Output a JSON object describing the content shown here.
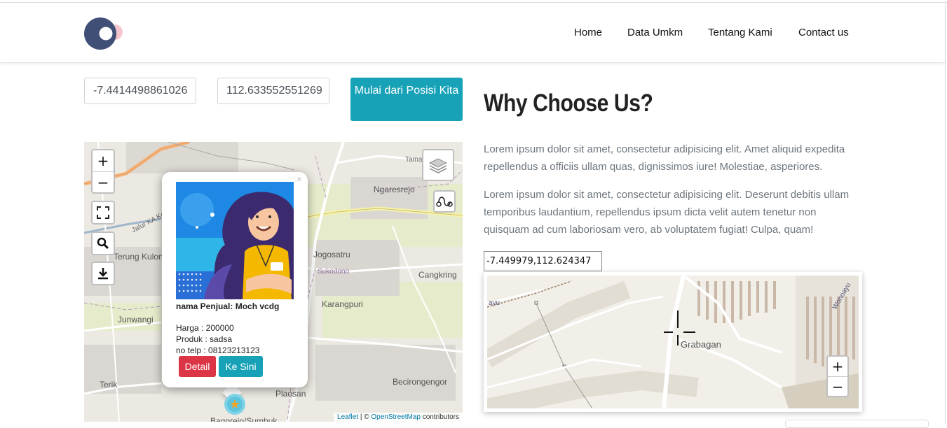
{
  "nav": {
    "items": [
      "Home",
      "Data Umkm",
      "Tentang Kami",
      "Contact us"
    ]
  },
  "start": {
    "lat_value": "-7.4414498861026",
    "lng_value": "112.633552551269",
    "button_label": "Mulai dari Posisi Kita"
  },
  "map1": {
    "labels": [
      "Ngaresrejo",
      "Jogosatru",
      "Sukodono",
      "Cangkring",
      "Karangpuri",
      "Terung Kulon",
      "Junwangi",
      "Terik",
      "Becirongengor",
      "Plaosan",
      "Jalur KA Kerta",
      "Tamat",
      "Bagorejo/Sumbuk"
    ],
    "popup": {
      "close": "×",
      "name": "nama Penjual: Moch vcdg",
      "harga": "Harga : 200000",
      "produk": "Produk : sadsa",
      "telp": "no telp : 08123213123",
      "detail_label": "Detail",
      "kesini_label": "Ke Sini"
    },
    "zoom_in": "+",
    "zoom_out": "−",
    "attribution_leaflet": "Leaflet",
    "attribution_sep": " | © ",
    "attribution_osm": "OpenStreetMap",
    "attribution_tail": " contributors"
  },
  "why": {
    "title": "Why Choose Us?",
    "para1": "Lorem ipsum dolor sit amet, consectetur adipisicing elit. Amet aliquid expedita repellendus a officiis ullam quas, dignissimos iure! Molestiae, asperiores.",
    "para2": "Lorem ipsum dolor sit amet, consectetur adipisicing elit. Deserunt debitis ullam temporibus laudantium, repellendus ipsum dicta velit autem tenetur non quisquam ad cum laboriosam vero, ab voluptatem fugiat! Culpa, quam!",
    "latlng": "-7.449979,112.624347"
  },
  "map2": {
    "labels": [
      "Grabagan",
      "Wonoayu",
      "ayu"
    ],
    "zoom_in": "+",
    "zoom_out": "−"
  },
  "colors": {
    "accent": "#17a2b8",
    "danger": "#dc3545",
    "logo_dark": "#3f4f75",
    "logo_pink": "#f6c6cf"
  }
}
